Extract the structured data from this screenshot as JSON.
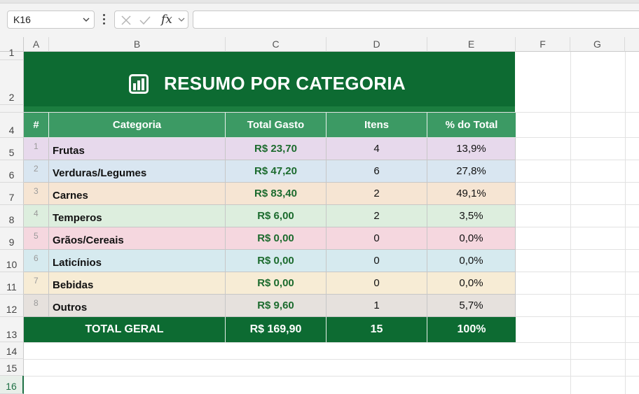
{
  "formula_bar": {
    "name_box": "K16",
    "fx_label": "fx",
    "formula": ""
  },
  "columns": [
    "A",
    "B",
    "C",
    "D",
    "E",
    "F",
    "G"
  ],
  "rows": [
    "1",
    "2",
    "3",
    "4",
    "5",
    "6",
    "7",
    "8",
    "9",
    "10",
    "11",
    "12",
    "13",
    "14",
    "15",
    "16"
  ],
  "selected_row": "16",
  "summary": {
    "title": "RESUMO POR CATEGORIA",
    "title_icon": "bar-chart-icon",
    "headers": [
      "#",
      "Categoria",
      "Total Gasto",
      "Itens",
      "% do Total"
    ],
    "items": [
      {
        "num": "1",
        "category": "Frutas",
        "total": "R$ 23,70",
        "items": "4",
        "pct": "13,9%",
        "color": "#e7d9ec"
      },
      {
        "num": "2",
        "category": "Verduras/Legumes",
        "total": "R$ 47,20",
        "items": "6",
        "pct": "27,8%",
        "color": "#d9e6f1"
      },
      {
        "num": "3",
        "category": "Carnes",
        "total": "R$ 83,40",
        "items": "2",
        "pct": "49,1%",
        "color": "#f6e5d3"
      },
      {
        "num": "4",
        "category": "Temperos",
        "total": "R$ 6,00",
        "items": "2",
        "pct": "3,5%",
        "color": "#ddeede"
      },
      {
        "num": "5",
        "category": "Grãos/Cereais",
        "total": "R$ 0,00",
        "items": "0",
        "pct": "0,0%",
        "color": "#f5d7df"
      },
      {
        "num": "6",
        "category": "Laticínios",
        "total": "R$ 0,00",
        "items": "0",
        "pct": "0,0%",
        "color": "#d6eaef"
      },
      {
        "num": "7",
        "category": "Bebidas",
        "total": "R$ 0,00",
        "items": "0",
        "pct": "0,0%",
        "color": "#f7ecd5"
      },
      {
        "num": "8",
        "category": "Outros",
        "total": "R$ 9,60",
        "items": "1",
        "pct": "5,7%",
        "color": "#e6e1dd"
      }
    ],
    "total_row": {
      "label": "TOTAL GERAL",
      "total": "R$ 169,90",
      "items": "15",
      "pct": "100%"
    }
  },
  "colors": {
    "dark_green": "#0d6b32",
    "header_green": "#3c9a64",
    "money_green": "#1c6b2e"
  }
}
